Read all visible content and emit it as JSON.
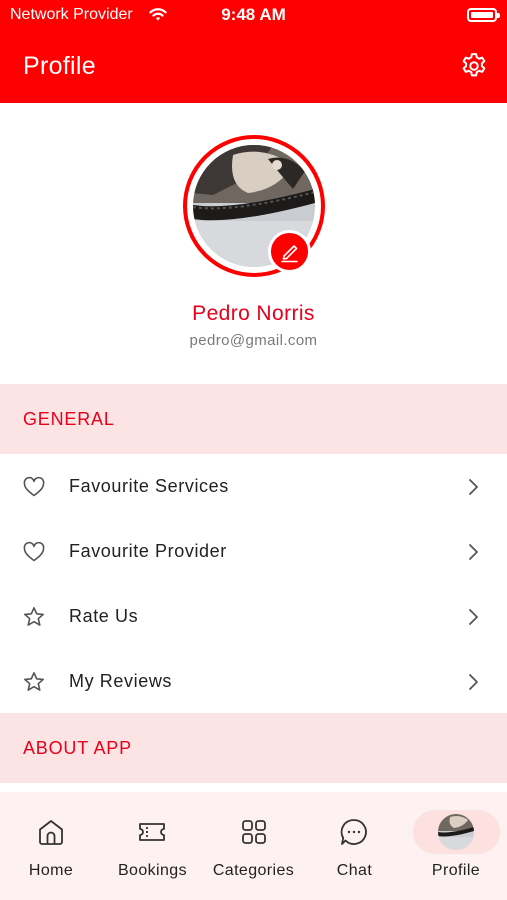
{
  "status_bar": {
    "carrier": "Network Provider",
    "time": "9:48 AM",
    "wifi_icon": "wifi-icon",
    "battery_icon": "battery-icon"
  },
  "app_bar": {
    "title": "Profile",
    "settings_icon": "gear-icon",
    "background": "#ff0000"
  },
  "profile": {
    "name": "Pedro Norris",
    "email": "pedro@gmail.com",
    "edit_icon": "pencil-icon",
    "accent": "#e8001a"
  },
  "sections": {
    "general": {
      "title": "GENERAL",
      "items": [
        {
          "label": "Favourite Services",
          "icon": "heart-icon"
        },
        {
          "label": "Favourite Provider",
          "icon": "heart-icon"
        },
        {
          "label": "Rate Us",
          "icon": "star-icon"
        },
        {
          "label": "My Reviews",
          "icon": "star-icon"
        }
      ]
    },
    "about": {
      "title": "ABOUT APP"
    }
  },
  "bottom_nav": {
    "items": [
      {
        "label": "Home",
        "icon": "home-icon"
      },
      {
        "label": "Bookings",
        "icon": "ticket-icon"
      },
      {
        "label": "Categories",
        "icon": "grid-icon"
      },
      {
        "label": "Chat",
        "icon": "chat-icon"
      },
      {
        "label": "Profile",
        "icon": "avatar",
        "active": true
      }
    ],
    "background": "#fdf1f1",
    "active_pill": "#fde0e0"
  }
}
